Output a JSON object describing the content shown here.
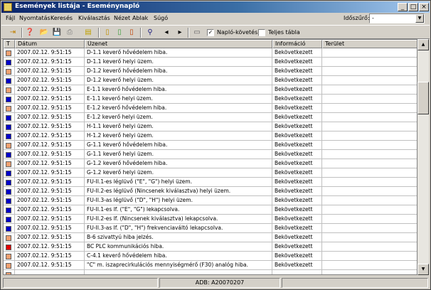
{
  "window": {
    "title": "Események listája - Eseménynapló"
  },
  "titlebar_buttons": [
    "_",
    "□",
    "×"
  ],
  "menu": [
    "Fájl",
    "Nyomtatás",
    "Keresés",
    "Kiválasztás",
    "Nézet",
    "Ablak",
    "Súgó"
  ],
  "filter": {
    "label": "Időszűrő:",
    "value": "-"
  },
  "toolbar": {
    "checkbox_naplo": {
      "label": "Napló-követés",
      "checked": true
    },
    "checkbox_teljes": {
      "label": "Teljes tábla",
      "checked": false
    }
  },
  "table": {
    "columns": [
      "T",
      "Dátum",
      "Üzenet",
      "Információ",
      "Terület"
    ],
    "rows": [
      {
        "type": "orange",
        "date": "2007.02.12. 9:51:15",
        "message": "D-1.1 keverő hővédelem hiba.",
        "info": "Bekövetkezett",
        "area": ""
      },
      {
        "type": "blue",
        "date": "2007.02.12. 9:51:15",
        "message": "D-1.1 keverő helyi üzem.",
        "info": "Bekövetkezett",
        "area": ""
      },
      {
        "type": "orange",
        "date": "2007.02.12. 9:51:15",
        "message": "D-1.2 keverő hővédelem hiba.",
        "info": "Bekövetkezett",
        "area": ""
      },
      {
        "type": "blue",
        "date": "2007.02.12. 9:51:15",
        "message": "D-1.2 keverő helyi üzem.",
        "info": "Bekövetkezett",
        "area": ""
      },
      {
        "type": "orange",
        "date": "2007.02.12. 9:51:15",
        "message": "E-1.1 keverő hővédelem hiba.",
        "info": "Bekövetkezett",
        "area": ""
      },
      {
        "type": "blue",
        "date": "2007.02.12. 9:51:15",
        "message": "E-1.1 keverő helyi üzem.",
        "info": "Bekövetkezett",
        "area": ""
      },
      {
        "type": "orange",
        "date": "2007.02.12. 9:51:15",
        "message": "E-1.2 keverő hővédelem hiba.",
        "info": "Bekövetkezett",
        "area": ""
      },
      {
        "type": "blue",
        "date": "2007.02.12. 9:51:15",
        "message": "E-1.2 keverő helyi üzem.",
        "info": "Bekövetkezett",
        "area": ""
      },
      {
        "type": "blue",
        "date": "2007.02.12. 9:51:15",
        "message": "H-1.1 keverő helyi üzem.",
        "info": "Bekövetkezett",
        "area": ""
      },
      {
        "type": "blue",
        "date": "2007.02.12. 9:51:15",
        "message": "H-1.2 keverő helyi üzem.",
        "info": "Bekövetkezett",
        "area": ""
      },
      {
        "type": "orange",
        "date": "2007.02.12. 9:51:15",
        "message": "G-1.1 keverő hővédelem hiba.",
        "info": "Bekövetkezett",
        "area": ""
      },
      {
        "type": "blue",
        "date": "2007.02.12. 9:51:15",
        "message": "G-1.1 keverő helyi üzem.",
        "info": "Bekövetkezett",
        "area": ""
      },
      {
        "type": "orange",
        "date": "2007.02.12. 9:51:15",
        "message": "G-1.2 keverő hővédelem hiba.",
        "info": "Bekövetkezett",
        "area": ""
      },
      {
        "type": "blue",
        "date": "2007.02.12. 9:51:15",
        "message": "G-1.2 keverő helyi üzem.",
        "info": "Bekövetkezett",
        "area": ""
      },
      {
        "type": "blue",
        "date": "2007.02.12. 9:51:15",
        "message": "FU-II.1-es léglüvő (\"E\", \"G\") helyi üzem.",
        "info": "Bekövetkezett",
        "area": ""
      },
      {
        "type": "blue",
        "date": "2007.02.12. 9:51:15",
        "message": "FU-II.2-es léglüvő (Nincsenek kiválasztva) helyi üzem.",
        "info": "Bekövetkezett",
        "area": ""
      },
      {
        "type": "blue",
        "date": "2007.02.12. 9:51:15",
        "message": "FU-II.3-as léglüvő (\"D\", \"H\") helyi üzem.",
        "info": "Bekövetkezett",
        "area": ""
      },
      {
        "type": "blue",
        "date": "2007.02.12. 9:51:15",
        "message": "FU-II.1-es lf. (\"E\", \"G\") lekapcsolva.",
        "info": "Bekövetkezett",
        "area": ""
      },
      {
        "type": "blue",
        "date": "2007.02.12. 9:51:15",
        "message": "FU-II.2-es lf. (Nincsenek kiválasztva) lekapcsolva.",
        "info": "Bekövetkezett",
        "area": ""
      },
      {
        "type": "blue",
        "date": "2007.02.12. 9:51:15",
        "message": "FU-II.3-as lf. (\"D\", \"H\") frekvenciaváltó lekapcsolva.",
        "info": "Bekövetkezett",
        "area": ""
      },
      {
        "type": "orange",
        "date": "2007.02.12. 9:51:15",
        "message": "B-6 szivattyú hiba jelzés.",
        "info": "Bekövetkezett",
        "area": ""
      },
      {
        "type": "red",
        "date": "2007.02.12. 9:51:15",
        "message": "BC PLC kommunikációs hiba.",
        "info": "Bekövetkezett",
        "area": ""
      },
      {
        "type": "orange",
        "date": "2007.02.12. 9:51:15",
        "message": "C-4.1 keverő hővédelem hiba.",
        "info": "Bekövetkezett",
        "area": ""
      },
      {
        "type": "orange",
        "date": "2007.02.12. 9:51:15",
        "message": "\"C\" m. iszaprecirkulációs mennyiségmérő (F30) analóg hiba.",
        "info": "Bekövetkezett",
        "area": ""
      },
      {
        "type": "orange",
        "date": "",
        "message": "",
        "info": "",
        "area": ""
      }
    ]
  },
  "colors": {
    "orange": "#f0a070",
    "blue": "#0000c8",
    "red": "#e00000",
    "title_active": "#0a246a"
  },
  "status": {
    "panel1": "",
    "panel2": "ADB: A20070207",
    "panel3": ""
  }
}
